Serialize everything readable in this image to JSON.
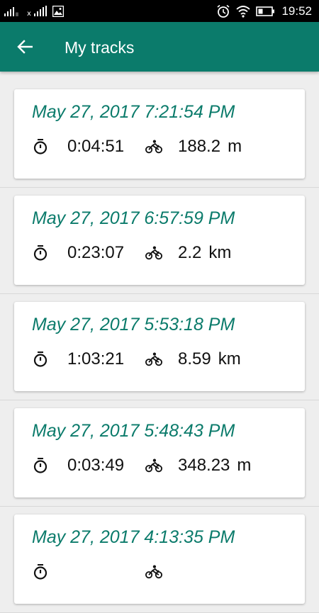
{
  "status_bar": {
    "time": "19:52",
    "icons": [
      "signal-icon",
      "signal-no-sim-icon",
      "image-notification-icon",
      "alarm-icon",
      "wifi-icon",
      "battery-icon"
    ]
  },
  "app_bar": {
    "title": "My tracks",
    "back_icon": "arrow-back-icon",
    "color": "#0b7b6b"
  },
  "tracks": [
    {
      "date": "May 27, 2017 7:21:54 PM",
      "duration": "0:04:51",
      "distance": "188.2",
      "unit": "m"
    },
    {
      "date": "May 27, 2017 6:57:59 PM",
      "duration": "0:23:07",
      "distance": "2.2",
      "unit": "km"
    },
    {
      "date": "May 27, 2017 5:53:18 PM",
      "duration": "1:03:21",
      "distance": "8.59",
      "unit": "km"
    },
    {
      "date": "May 27, 2017 5:48:43 PM",
      "duration": "0:03:49",
      "distance": "348.23",
      "unit": "m"
    },
    {
      "date": "May 27, 2017 4:13:35 PM",
      "duration": "",
      "distance": "",
      "unit": ""
    }
  ],
  "icons": {
    "duration": "stopwatch-icon",
    "activity": "bicycle-icon"
  }
}
